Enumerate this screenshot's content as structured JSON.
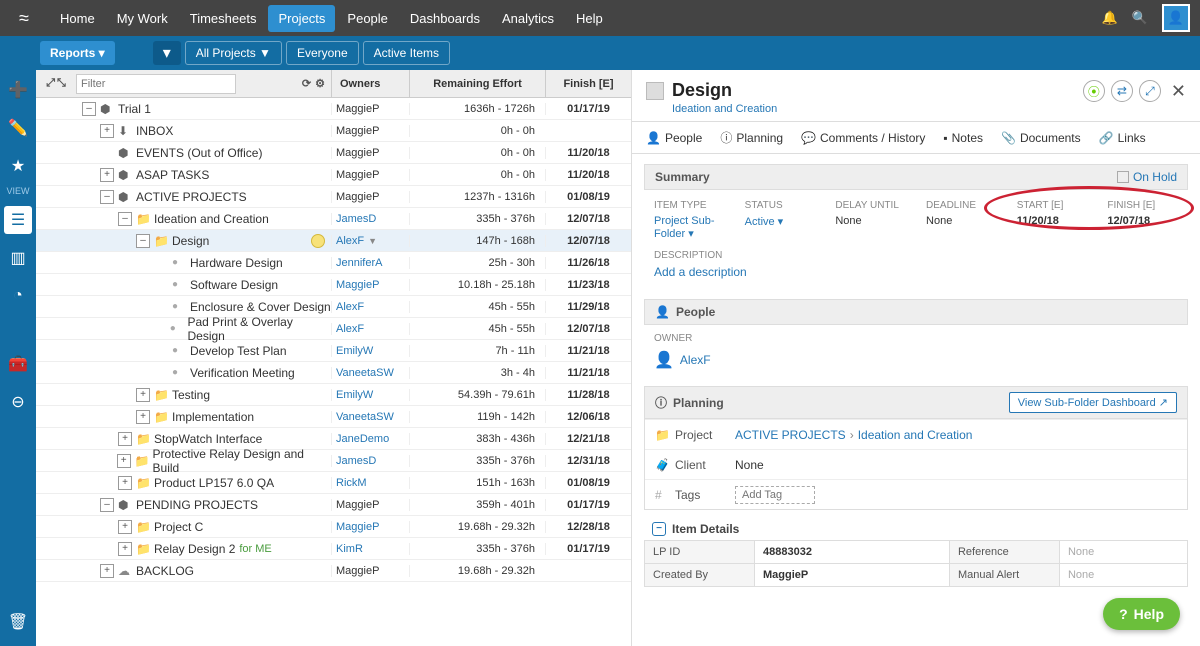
{
  "topnav": {
    "items": [
      "Home",
      "My Work",
      "Timesheets",
      "Projects",
      "People",
      "Dashboards",
      "Analytics",
      "Help"
    ],
    "active": "Projects"
  },
  "subnav": {
    "reports": "Reports ▾",
    "pill_all_projects": "All Projects ▼",
    "pill_everyone": "Everyone",
    "pill_active": "Active Items"
  },
  "grid": {
    "filter_placeholder": "Filter",
    "col_owners": "Owners",
    "col_effort": "Remaining Effort",
    "col_finish": "Finish [E]",
    "rows": [
      {
        "indent": 0,
        "toggle": "-",
        "icon": "pkg",
        "name": "Trial 1",
        "owner": "MaggieP",
        "ownerPlain": true,
        "effort": "1636h - 1726h",
        "finish": "01/17/19"
      },
      {
        "indent": 1,
        "toggle": "+",
        "icon": "inbox",
        "name": "INBOX",
        "owner": "MaggieP",
        "ownerPlain": true,
        "effort": "0h - 0h",
        "finish": ""
      },
      {
        "indent": 1,
        "toggle": "",
        "icon": "pkg",
        "name": "EVENTS (Out of Office)",
        "owner": "MaggieP",
        "ownerPlain": true,
        "effort": "0h - 0h",
        "finish": "11/20/18"
      },
      {
        "indent": 1,
        "toggle": "+",
        "icon": "pkg",
        "name": "ASAP TASKS",
        "owner": "MaggieP",
        "ownerPlain": true,
        "effort": "0h - 0h",
        "finish": "11/20/18"
      },
      {
        "indent": 1,
        "toggle": "-",
        "icon": "pkg",
        "name": "ACTIVE PROJECTS",
        "owner": "MaggieP",
        "ownerPlain": true,
        "effort": "1237h - 1316h",
        "finish": "01/08/19"
      },
      {
        "indent": 2,
        "toggle": "-",
        "icon": "folder-blue",
        "name": "Ideation and Creation",
        "owner": "JamesD",
        "effort": "335h - 376h",
        "finish": "12/07/18"
      },
      {
        "indent": 3,
        "toggle": "-",
        "icon": "folder-grey",
        "name": "Design",
        "owner": "AlexF",
        "ownerDrop": true,
        "effort": "147h - 168h",
        "finish": "12/07/18",
        "selected": true,
        "badge": true
      },
      {
        "indent": 4,
        "toggle": "",
        "icon": "dot",
        "name": "Hardware Design",
        "owner": "JenniferA",
        "effort": "25h - 30h",
        "finish": "11/26/18"
      },
      {
        "indent": 4,
        "toggle": "",
        "icon": "dot",
        "name": "Software Design",
        "owner": "MaggieP",
        "effort": "10.18h - 25.18h",
        "finish": "11/23/18"
      },
      {
        "indent": 4,
        "toggle": "",
        "icon": "dot",
        "name": "Enclosure & Cover Design",
        "owner": "AlexF",
        "effort": "45h - 55h",
        "finish": "11/29/18"
      },
      {
        "indent": 4,
        "toggle": "",
        "icon": "dot",
        "name": "Pad Print & Overlay Design",
        "owner": "AlexF",
        "effort": "45h - 55h",
        "finish": "12/07/18"
      },
      {
        "indent": 4,
        "toggle": "",
        "icon": "dot",
        "name": "Develop Test Plan",
        "owner": "EmilyW",
        "effort": "7h - 11h",
        "finish": "11/21/18"
      },
      {
        "indent": 4,
        "toggle": "",
        "icon": "dot",
        "name": "Verification Meeting",
        "owner": "VaneetaSW",
        "effort": "3h - 4h",
        "finish": "11/21/18"
      },
      {
        "indent": 3,
        "toggle": "+",
        "icon": "folder-grey",
        "name": "Testing",
        "owner": "EmilyW",
        "effort": "54.39h - 79.61h",
        "finish": "11/28/18"
      },
      {
        "indent": 3,
        "toggle": "+",
        "icon": "folder-grey",
        "name": "Implementation",
        "owner": "VaneetaSW",
        "effort": "119h - 142h",
        "finish": "12/06/18"
      },
      {
        "indent": 2,
        "toggle": "+",
        "icon": "folder-blue",
        "name": "StopWatch Interface",
        "owner": "JaneDemo",
        "effort": "383h - 436h",
        "finish": "12/21/18"
      },
      {
        "indent": 2,
        "toggle": "+",
        "icon": "folder-blue",
        "name": "Protective Relay Design and Build",
        "owner": "JamesD",
        "effort": "335h - 376h",
        "finish": "12/31/18"
      },
      {
        "indent": 2,
        "toggle": "+",
        "icon": "folder-blue",
        "name": "Product LP157 6.0 QA",
        "owner": "RickM",
        "effort": "151h - 163h",
        "finish": "01/08/19"
      },
      {
        "indent": 1,
        "toggle": "-",
        "icon": "pkg",
        "name": "PENDING PROJECTS",
        "owner": "MaggieP",
        "ownerPlain": true,
        "effort": "359h - 401h",
        "finish": "01/17/19"
      },
      {
        "indent": 2,
        "toggle": "+",
        "icon": "folder-blue",
        "name": "Project C",
        "owner": "MaggieP",
        "effort": "19.68h - 29.32h",
        "finish": "12/28/18"
      },
      {
        "indent": 2,
        "toggle": "+",
        "icon": "folder-blue",
        "name": "Relay Design 2",
        "forMe": "for ME",
        "owner": "KimR",
        "effort": "335h - 376h",
        "finish": "01/17/19"
      },
      {
        "indent": 1,
        "toggle": "+",
        "icon": "cloud",
        "name": "BACKLOG",
        "owner": "MaggieP",
        "ownerPlain": true,
        "effort": "19.68h - 29.32h",
        "finish": ""
      }
    ]
  },
  "detail": {
    "title": "Design",
    "breadcrumb": "Ideation and Creation",
    "tabs": {
      "people": "People",
      "planning": "Planning",
      "comments": "Comments / History",
      "notes": "Notes",
      "documents": "Documents",
      "links": "Links"
    },
    "summary": {
      "header": "Summary",
      "on_hold": "On Hold",
      "item_type_label": "ITEM TYPE",
      "item_type_value": "Project Sub-Folder ▾",
      "status_label": "STATUS",
      "status_value": "Active ▾",
      "delay_label": "DELAY UNTIL",
      "delay_value": "None",
      "deadline_label": "DEADLINE",
      "deadline_value": "None",
      "start_label": "START [E]",
      "start_value": "11/20/18",
      "finish_label": "FINISH [E]",
      "finish_value": "12/07/18"
    },
    "description_label": "DESCRIPTION",
    "description_add": "Add a description",
    "people_header": "People",
    "owner_label": "OWNER",
    "owner_value": "AlexF",
    "planning_header": "Planning",
    "view_dashboard": "View Sub-Folder Dashboard ↗",
    "plan_project_label": "Project",
    "plan_project_val1": "ACTIVE PROJECTS",
    "plan_project_val2": "Ideation and Creation",
    "plan_client_label": "Client",
    "plan_client_value": "None",
    "plan_tags_label": "Tags",
    "plan_tags_placeholder": "Add Tag",
    "item_details_header": "Item Details",
    "details": {
      "lp_id_k": "LP ID",
      "lp_id_v": "48883032",
      "reference_k": "Reference",
      "reference_v": "None",
      "created_by_k": "Created By",
      "created_by_v": "MaggieP",
      "manual_alert_k": "Manual Alert",
      "manual_alert_v": "None"
    }
  },
  "help_label": "Help"
}
